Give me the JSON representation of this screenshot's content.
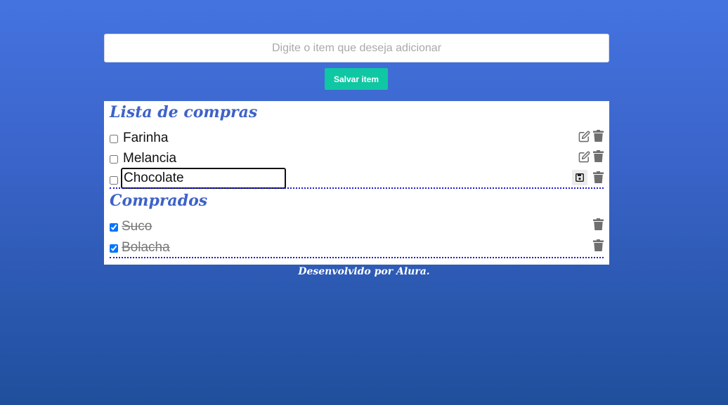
{
  "form": {
    "input_placeholder": "Digite o item que deseja adicionar",
    "input_value": "",
    "save_label": "Salvar item"
  },
  "shopping_list": {
    "title": "Lista de compras",
    "items": [
      {
        "label": "Farinha",
        "checked": false
      },
      {
        "label": "Melancia",
        "checked": false
      },
      {
        "label": "Chocolate",
        "checked": false,
        "editing": true
      }
    ]
  },
  "purchased": {
    "title": "Comprados",
    "items": [
      {
        "label": "Suco",
        "checked": true
      },
      {
        "label": "Bolacha",
        "checked": true
      }
    ]
  },
  "footer": {
    "text": "Desenvolvido por Alura."
  },
  "colors": {
    "accent": "#3d62c8",
    "button": "#0fc7a3",
    "divider": "#1a1ad6"
  },
  "icons": {
    "edit": "edit-icon",
    "trash": "trash-icon",
    "save": "floppy-disk-icon"
  }
}
